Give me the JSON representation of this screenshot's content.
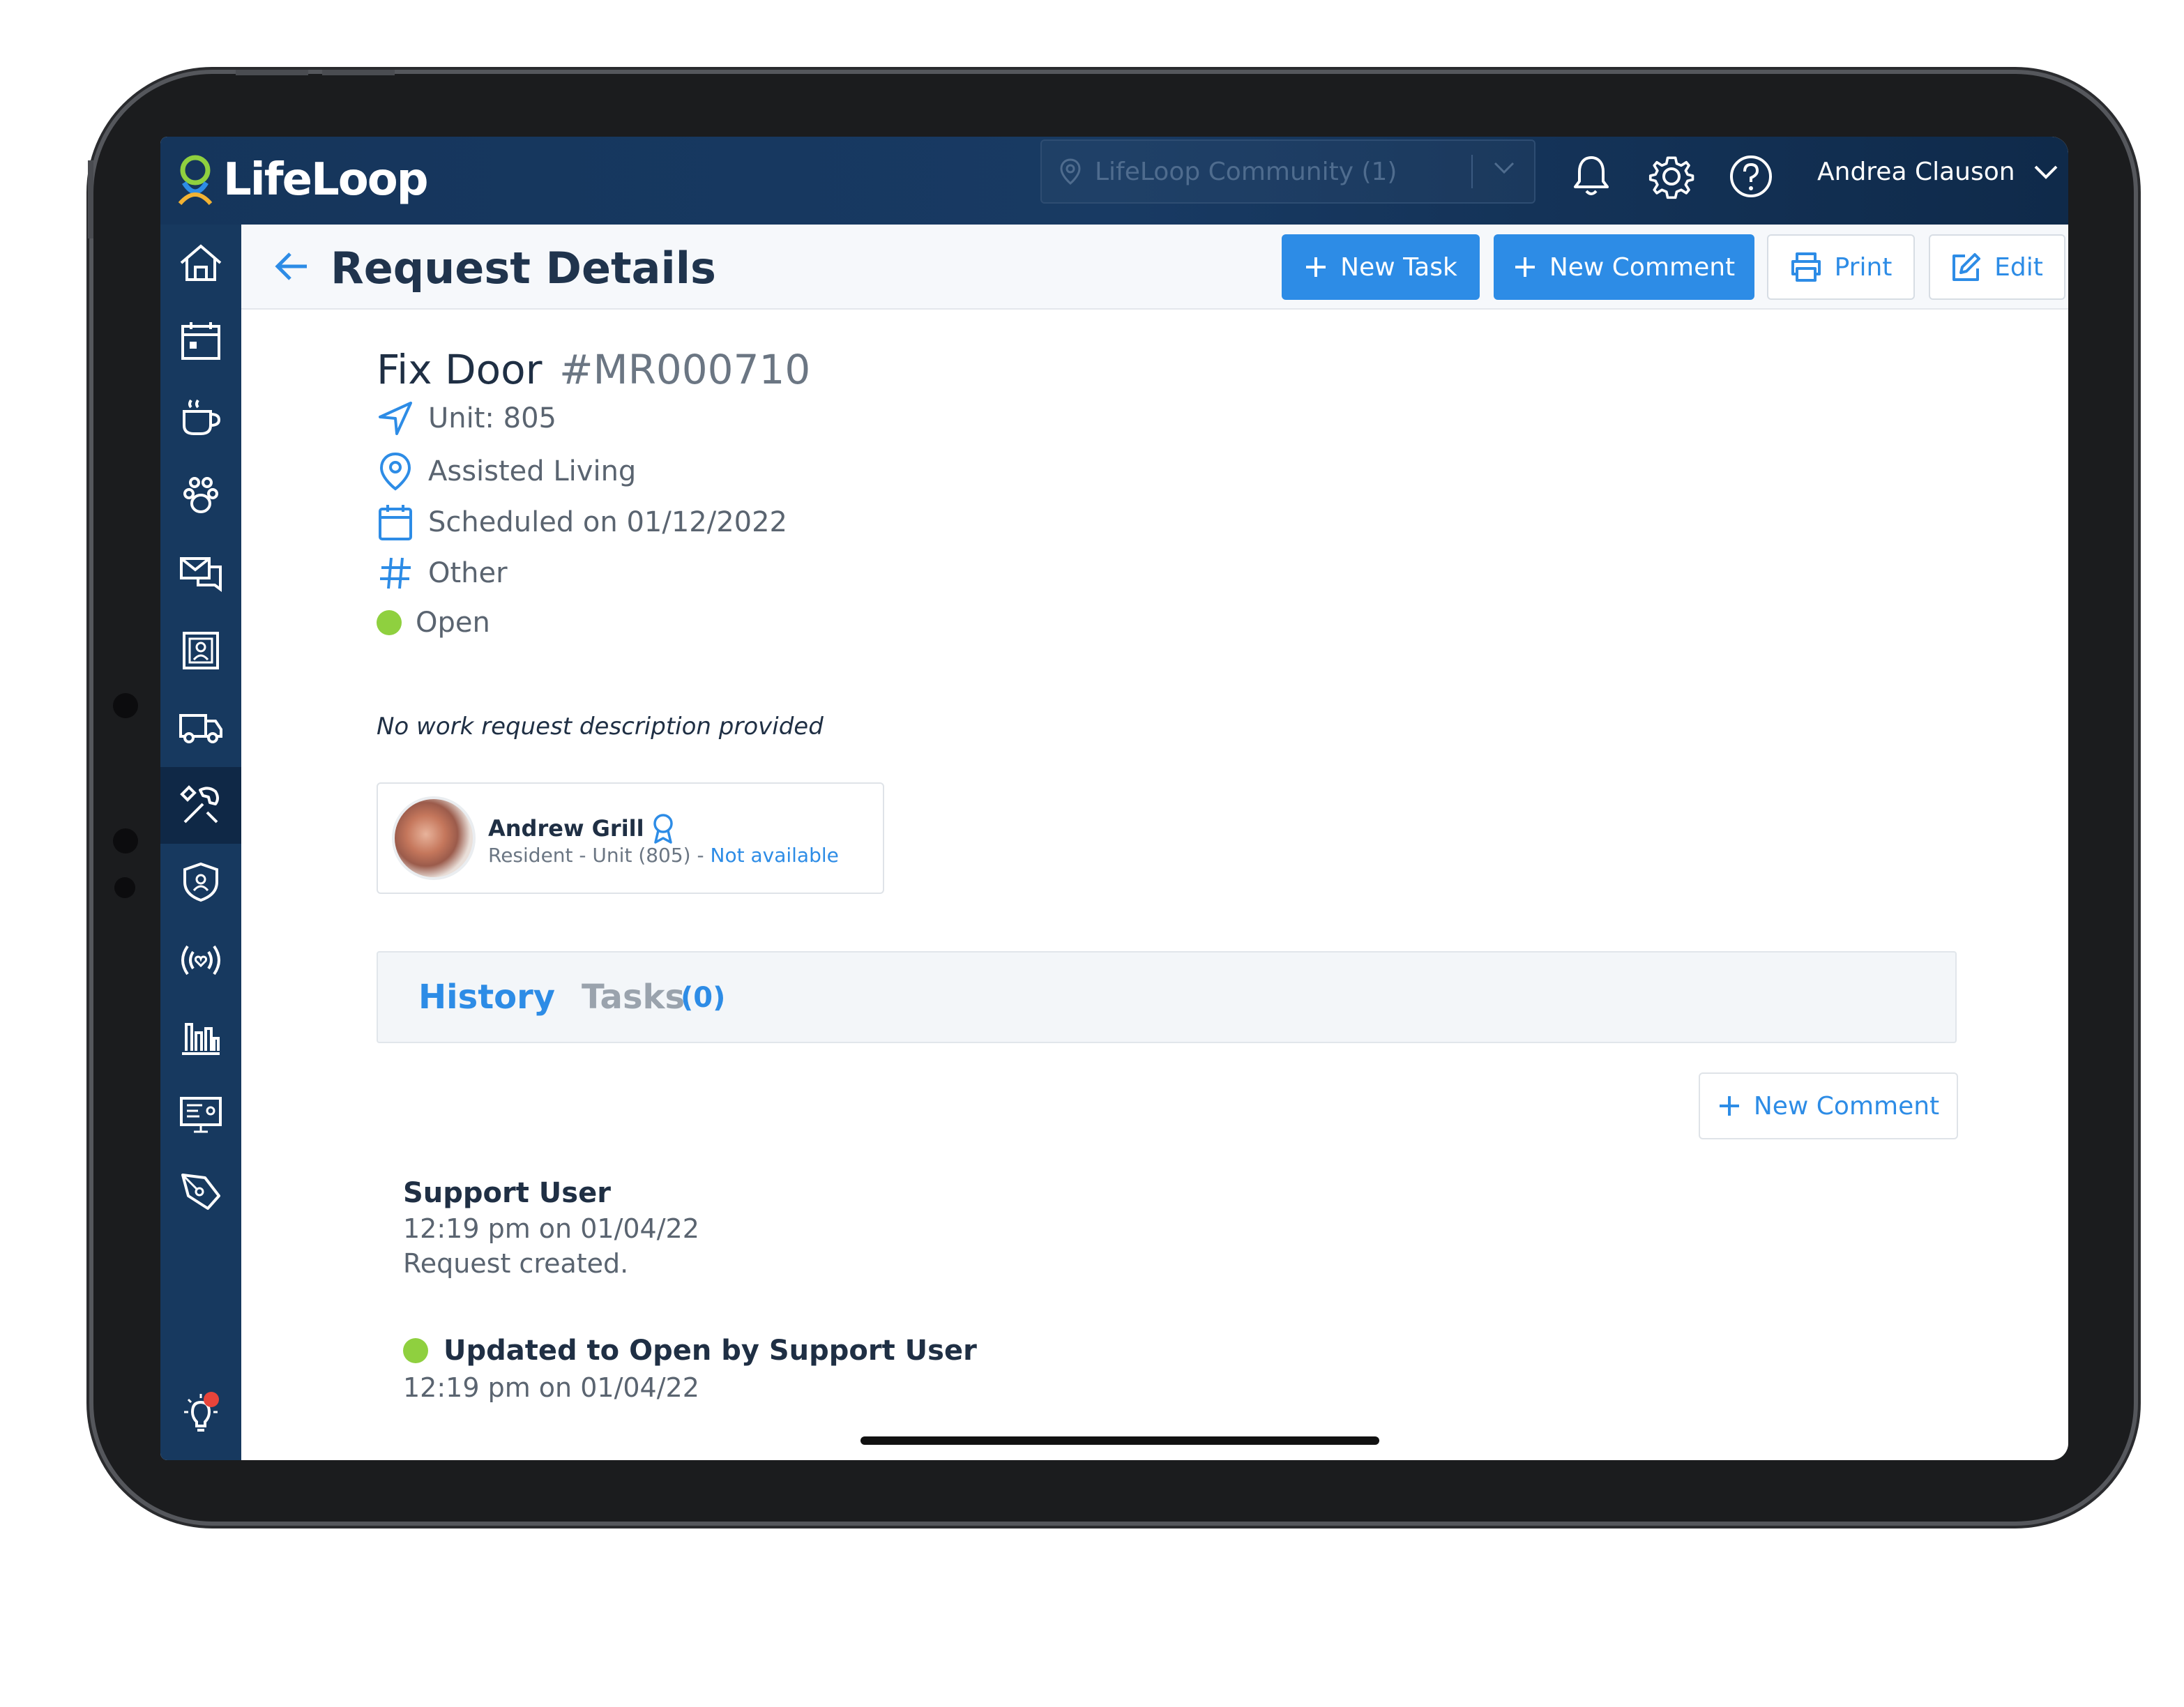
{
  "app": {
    "logo_text": "LifeLoop",
    "community_selector": "LifeLoop Community (1)",
    "user_name": "Andrea Clauson"
  },
  "header_icons": [
    "bell-icon",
    "gear-icon",
    "help-icon"
  ],
  "sidebar": {
    "items": [
      "home-icon",
      "calendar-icon",
      "coffee-icon",
      "paw-icon",
      "messages-icon",
      "directory-icon",
      "transport-icon",
      "maintenance-icon",
      "security-icon",
      "broadcast-icon",
      "reports-icon",
      "signage-icon",
      "forms-icon"
    ],
    "active": "maintenance-icon",
    "footer_icon": "lightbulb-icon"
  },
  "page": {
    "title": "Request Details",
    "actions": {
      "new_task": "New Task",
      "new_comment": "New Comment",
      "print": "Print",
      "edit": "Edit"
    }
  },
  "request": {
    "title": "Fix Door",
    "id": "#MR000710",
    "unit": "Unit: 805",
    "location": "Assisted Living",
    "scheduled": "Scheduled on 01/12/2022",
    "category": "Other",
    "status": "Open",
    "description": "No work request description provided"
  },
  "resident": {
    "name": "Andrew Grill",
    "detail": "Resident - Unit (805) - ",
    "availability": "Not available"
  },
  "tabs": {
    "history": "History",
    "tasks": "Tasks",
    "tasks_count": "(0)"
  },
  "history": {
    "new_comment": "New Comment",
    "entries": [
      {
        "user": "Support User",
        "time": "12:19 pm on 01/04/22",
        "text": "Request created."
      },
      {
        "status": "Updated to Open by Support User",
        "time": "12:19 pm on 01/04/22"
      }
    ]
  },
  "colors": {
    "primary": "#2d8ce6",
    "topbar": "#15355b",
    "sidebar": "#17395f",
    "status_open": "#8fd03f"
  }
}
